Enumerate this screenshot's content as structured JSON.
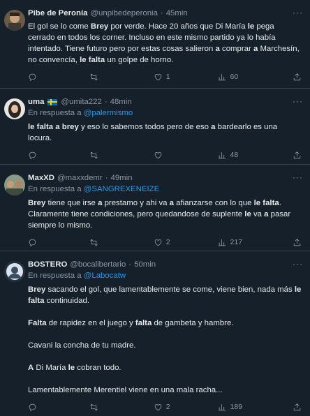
{
  "tweets": [
    {
      "name": "Pibe de Peronía",
      "flag": false,
      "handle": "@unpibedeperonia",
      "time": "45min",
      "reply_prefix": "",
      "reply_to": "",
      "body_html": "El gol se lo come <b>Brey</b> por verde. Hace 20 años que Di María <b>le</b> pega cerrado en todos los corner. Incluso en este mismo partido ya lo había intentado. Tiene futuro pero por estas cosas salieron <b>a</b> comprar <b>a</b> Marchesín, no convencía, <b>le falta</b> un golpe de horno.",
      "replies": "",
      "retweets": "",
      "likes": "1",
      "views": "60"
    },
    {
      "name": "uma",
      "flag": true,
      "handle": "@umita222",
      "time": "48min",
      "reply_prefix": "En respuesta a",
      "reply_to": "@palermismo",
      "body_html": "<b>le falta a brey</b> y eso lo sabemos todos pero de eso <b>a</b> bardearlo es una locura.",
      "replies": "",
      "retweets": "",
      "likes": "",
      "views": "48"
    },
    {
      "name": "MaxXD",
      "flag": false,
      "handle": "@maxxdemr",
      "time": "49min",
      "reply_prefix": "En respuesta a",
      "reply_to": "@SANGREXENEIZE",
      "body_html": "<b>Brey</b> tiene que irse <b>a</b> prestamo y ahi va <b>a</b> afianzarse con lo que <b>le falta</b>.\nClaramente tiene condiciones, pero quedandose de suplente <b>le</b> va <b>a</b> pasar siempre lo mismo.",
      "replies": "",
      "retweets": "",
      "likes": "2",
      "views": "217"
    },
    {
      "name": "BOSTERO",
      "flag": false,
      "handle": "@bocalibertario",
      "time": "50min",
      "reply_prefix": "En respuesta a",
      "reply_to": "@Labocatw",
      "body_html": "<b>Brey</b> sacando el gol, que lamentablemente se come, viene bien, nada más <b>le falta</b> continuidad.\n\n<b>Falta</b> de rapidez en el juego y <b>falta</b> de gambeta y hambre.\n\nCavani la concha de tu madre.\n\n<b>A</b> Di María <b>le</b> cobran todo.\n\nLamentablemente Merentiel viene en una mala racha...",
      "replies": "",
      "retweets": "",
      "likes": "2",
      "views": "189"
    }
  ],
  "more_label": "···",
  "colors": {
    "background": "#15202b",
    "border": "#38444d",
    "link": "#1d9bf0",
    "muted": "#8b98a5"
  },
  "icons": [
    "reply-icon",
    "retweet-icon",
    "like-icon",
    "views-icon",
    "share-icon",
    "more-icon"
  ]
}
